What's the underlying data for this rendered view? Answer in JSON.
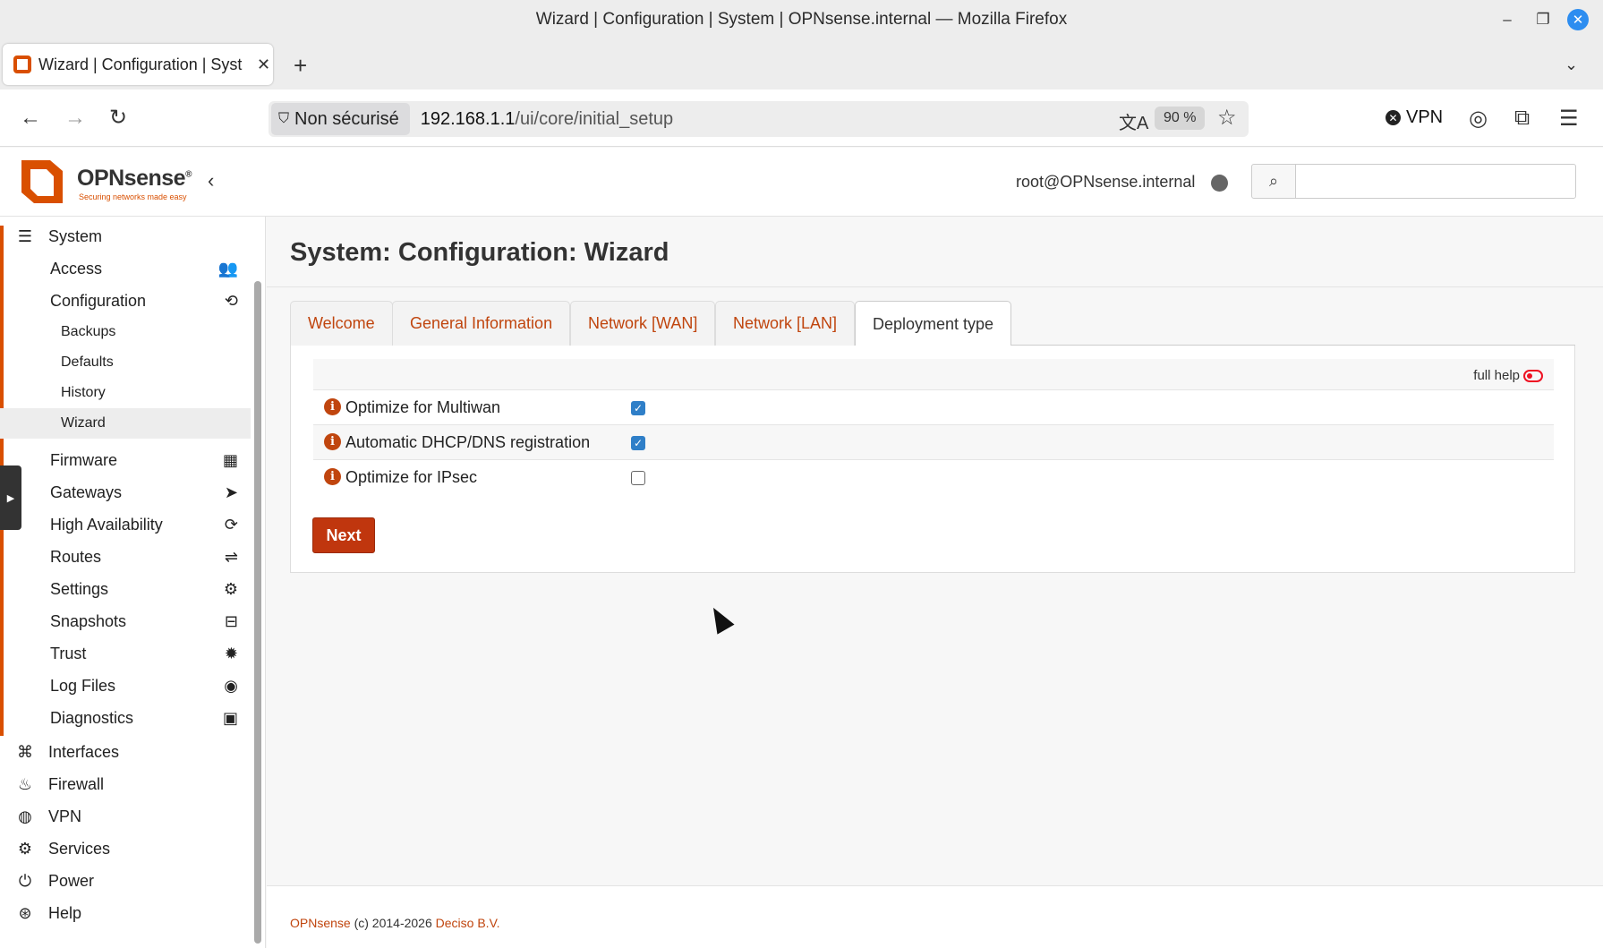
{
  "window": {
    "title": "Wizard | Configuration | System | OPNsense.internal — Mozilla Firefox",
    "minimize": "–",
    "maximize": "❐",
    "close": "✕"
  },
  "browser": {
    "tab_title": "Wizard | Configuration | Syst",
    "tab_close": "✕",
    "new_tab": "+",
    "tab_list": "⌄",
    "back": "←",
    "forward": "→",
    "reload": "↻",
    "security_label": "Non sécurisé",
    "url_host": "192.168.1.1",
    "url_path": "/ui/core/initial_setup",
    "zoom": "90 %",
    "vpn_label": "VPN",
    "translate_icon": "文A",
    "icons": [
      "translate-icon",
      "star-icon",
      "account-icon",
      "extensions-icon",
      "menu-icon"
    ]
  },
  "header": {
    "brand": "OPNsense",
    "brand_mark": "®",
    "tagline": "Securing networks made easy",
    "collapse": "‹",
    "user": "root@OPNsense.internal",
    "search_placeholder": ""
  },
  "sidebar": {
    "system_label": "System",
    "system_items": [
      {
        "label": "Access",
        "icon": "users-icon",
        "glyph": "👥"
      },
      {
        "label": "Configuration",
        "icon": "history-icon",
        "glyph": "⟲"
      },
      {
        "label": "Firmware",
        "icon": "firmware-icon",
        "glyph": "▦"
      },
      {
        "label": "Gateways",
        "icon": "location-arrow-icon",
        "glyph": "➤"
      },
      {
        "label": "High Availability",
        "icon": "refresh-icon",
        "glyph": "⟳"
      },
      {
        "label": "Routes",
        "icon": "signpost-icon",
        "glyph": "⇌"
      },
      {
        "label": "Settings",
        "icon": "cogs-icon",
        "glyph": "⚙"
      },
      {
        "label": "Snapshots",
        "icon": "hdd-icon",
        "glyph": "⊟"
      },
      {
        "label": "Trust",
        "icon": "certificate-icon",
        "glyph": "✹"
      },
      {
        "label": "Log Files",
        "icon": "eye-icon",
        "glyph": "◉"
      },
      {
        "label": "Diagnostics",
        "icon": "medkit-icon",
        "glyph": "▣"
      }
    ],
    "config_items": [
      {
        "label": "Backups"
      },
      {
        "label": "Defaults"
      },
      {
        "label": "History"
      },
      {
        "label": "Wizard",
        "active": true
      }
    ],
    "top_items": [
      {
        "label": "Interfaces",
        "icon": "sitemap-icon",
        "glyph": "⌘"
      },
      {
        "label": "Firewall",
        "icon": "fire-icon",
        "glyph": "♨"
      },
      {
        "label": "VPN",
        "icon": "globe-icon",
        "glyph": "◍"
      },
      {
        "label": "Services",
        "icon": "cog-icon",
        "glyph": "⚙"
      },
      {
        "label": "Power",
        "icon": "plug-icon",
        "glyph": "⏻"
      },
      {
        "label": "Help",
        "icon": "life-ring-icon",
        "glyph": "⊛"
      }
    ]
  },
  "main": {
    "title": "System: Configuration: Wizard",
    "tabs": [
      {
        "label": "Welcome"
      },
      {
        "label": "General Information"
      },
      {
        "label": "Network [WAN]"
      },
      {
        "label": "Network [LAN]"
      },
      {
        "label": "Deployment type",
        "active": true
      }
    ],
    "full_help_label": "full help",
    "options": [
      {
        "label": "Optimize for Multiwan",
        "checked": true
      },
      {
        "label": "Automatic DHCP/DNS registration",
        "checked": true
      },
      {
        "label": "Optimize for IPsec",
        "checked": false
      }
    ],
    "next_label": "Next"
  },
  "footer": {
    "brand_link": "OPNsense",
    "copyright": " (c) 2014-2026 ",
    "company_link": "Deciso B.V."
  },
  "colors": {
    "accent": "#d94f00",
    "link": "#c0450e",
    "button": "#c0360e",
    "checkbox": "#2f7fc8"
  }
}
